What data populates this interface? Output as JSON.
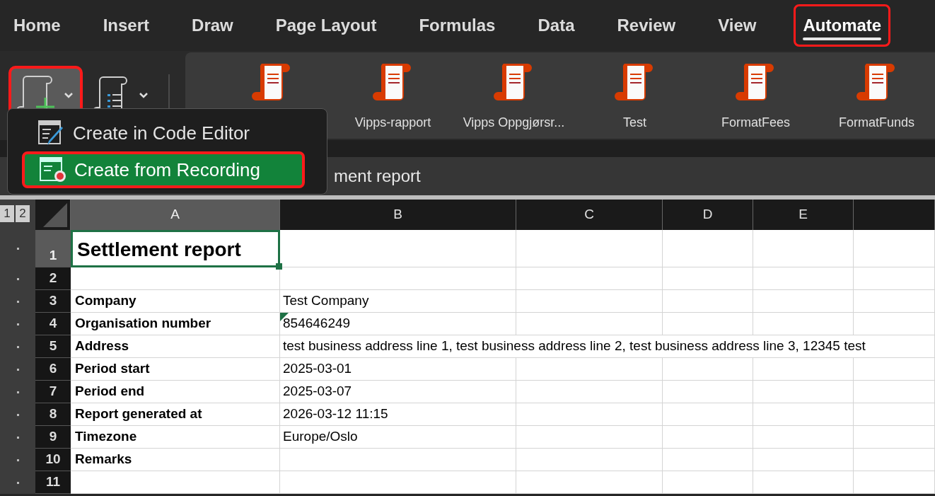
{
  "tabs": [
    {
      "label": "Home",
      "selected": false,
      "highlighted": false
    },
    {
      "label": "Insert",
      "selected": false,
      "highlighted": false
    },
    {
      "label": "Draw",
      "selected": false,
      "highlighted": false
    },
    {
      "label": "Page Layout",
      "selected": false,
      "highlighted": false
    },
    {
      "label": "Formulas",
      "selected": false,
      "highlighted": false
    },
    {
      "label": "Data",
      "selected": false,
      "highlighted": false
    },
    {
      "label": "Review",
      "selected": false,
      "highlighted": false
    },
    {
      "label": "View",
      "selected": false,
      "highlighted": false
    },
    {
      "label": "Automate",
      "selected": true,
      "highlighted": true
    }
  ],
  "ribbon": {
    "new_script_button": {
      "highlighted": true,
      "expanded": true
    },
    "scripts": [
      {
        "label": "Vipps-rapport"
      },
      {
        "label": "Vipps Oppgjørsr..."
      },
      {
        "label": "Test"
      },
      {
        "label": "FormatFees"
      },
      {
        "label": "FormatFunds"
      }
    ]
  },
  "menu": {
    "items": [
      {
        "kind": "code",
        "label": "Create in Code Editor",
        "selected": false,
        "highlighted": false
      },
      {
        "kind": "record",
        "label": "Create from Recording",
        "selected": true,
        "highlighted": true
      }
    ]
  },
  "title_bar": {
    "text": "ment report"
  },
  "sheet": {
    "outline_levels": [
      "1",
      "2"
    ],
    "columns": [
      {
        "label": "A",
        "selected": true
      },
      {
        "label": "B",
        "selected": false
      },
      {
        "label": "C",
        "selected": false
      },
      {
        "label": "D",
        "selected": false
      },
      {
        "label": "E",
        "selected": false
      },
      {
        "selected": false
      }
    ],
    "rows": [
      {
        "number": "1",
        "selected": true,
        "a": "Settlement report",
        "b": "",
        "flag": false,
        "overflow": false,
        "title": true
      },
      {
        "number": "2",
        "selected": false,
        "a": "",
        "b": "",
        "flag": false,
        "overflow": false,
        "title": false
      },
      {
        "number": "3",
        "selected": false,
        "a": "Company",
        "b": "Test Company",
        "flag": false,
        "overflow": false,
        "title": false
      },
      {
        "number": "4",
        "selected": false,
        "a": "Organisation number",
        "b": "854646249",
        "flag": true,
        "overflow": false,
        "title": false
      },
      {
        "number": "5",
        "selected": false,
        "a": "Address",
        "b": "test business address line 1, test business address line 2, test business address line 3, 12345 test",
        "flag": false,
        "overflow": true,
        "title": false
      },
      {
        "number": "6",
        "selected": false,
        "a": "Period start",
        "b": "2025-03-01",
        "flag": false,
        "overflow": false,
        "title": false
      },
      {
        "number": "7",
        "selected": false,
        "a": "Period end",
        "b": "2025-03-07",
        "flag": false,
        "overflow": false,
        "title": false
      },
      {
        "number": "8",
        "selected": false,
        "a": "Report generated at",
        "b": "2026-03-12 11:15",
        "flag": false,
        "overflow": false,
        "title": false
      },
      {
        "number": "9",
        "selected": false,
        "a": "Timezone",
        "b": "Europe/Oslo",
        "flag": false,
        "overflow": false,
        "title": false
      },
      {
        "number": "10",
        "selected": false,
        "a": "Remarks",
        "b": "",
        "flag": false,
        "overflow": false,
        "title": false
      },
      {
        "number": "11",
        "selected": false,
        "a": "",
        "b": "",
        "flag": false,
        "overflow": false,
        "title": false
      }
    ]
  }
}
